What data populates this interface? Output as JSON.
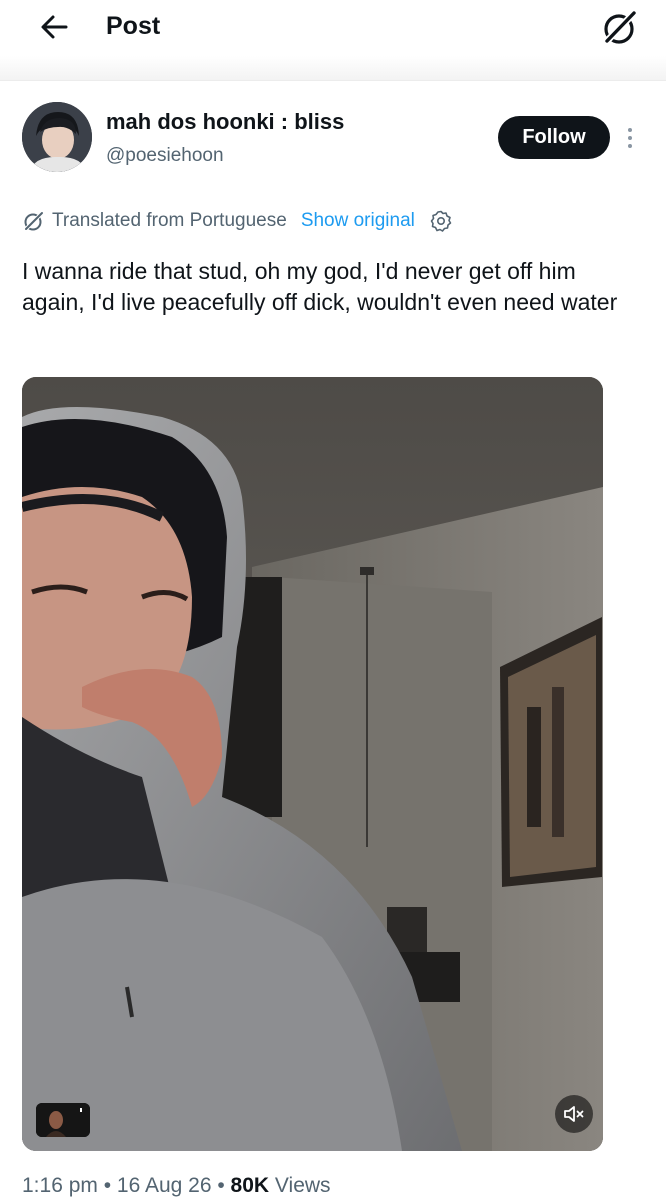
{
  "header": {
    "title": "Post"
  },
  "author": {
    "display_name": "mah dos hoonki : bliss",
    "handle": "@poesiehoon"
  },
  "follow_label": "Follow",
  "translation": {
    "label": "Translated from Portuguese",
    "show_original": "Show original"
  },
  "tweet": {
    "text": "I wanna ride that stud, oh my god, I'd never get off him again, I'd live peacefully off dick, wouldn't even need water"
  },
  "meta": {
    "time": "1:16 pm",
    "separator": " • ",
    "date": "16 Aug 26",
    "views_count": "80K",
    "views_label": "Views"
  },
  "icons": {
    "back": "arrow-left-icon",
    "grok": "grok-icon",
    "more": "more-vertical-icon",
    "translate": "grok-translate-icon",
    "settings": "gear-icon",
    "mute": "volume-muted-icon"
  },
  "colors": {
    "text": "#0f1419",
    "secondary": "#536471",
    "link": "#1d9bf0",
    "button": "#0f1419"
  }
}
